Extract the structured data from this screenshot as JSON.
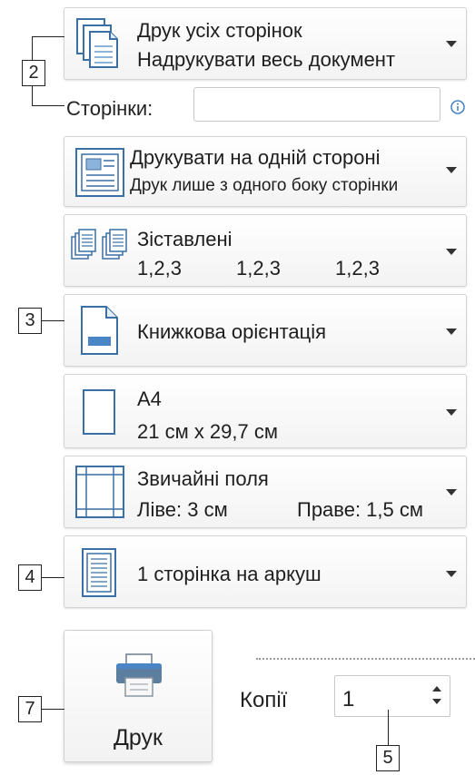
{
  "settings": {
    "pages": {
      "title": "Друк усіх сторінок",
      "subtitle": "Надрукувати весь документ"
    },
    "pages_field": {
      "label": "Сторінки:",
      "value": "",
      "info_icon": "info-icon"
    },
    "sides": {
      "title": "Друкувати на одній стороні",
      "subtitle": "Друк лише з одного боку сторінки"
    },
    "collate": {
      "title": "Зіставлені",
      "sequences": [
        "1,2,3",
        "1,2,3",
        "1,2,3"
      ]
    },
    "orientation": {
      "title": "Книжкова орієнтація"
    },
    "paper": {
      "title": "A4",
      "subtitle": "21 см x 29,7 см"
    },
    "margins": {
      "title": "Звичайні поля",
      "left": "Ліве: 3 см",
      "right": "Праве: 1,5 см"
    },
    "per_sheet": {
      "title": "1 сторінка на аркуш"
    }
  },
  "print": {
    "button_label": "Друк",
    "copies_label": "Копії",
    "copies_value": "1"
  },
  "callouts": {
    "c2": "2",
    "c3": "3",
    "c4": "4",
    "c5": "5",
    "c7": "7"
  },
  "colors": {
    "accent": "#4a86c6",
    "icon_line": "#3b6fa5"
  }
}
